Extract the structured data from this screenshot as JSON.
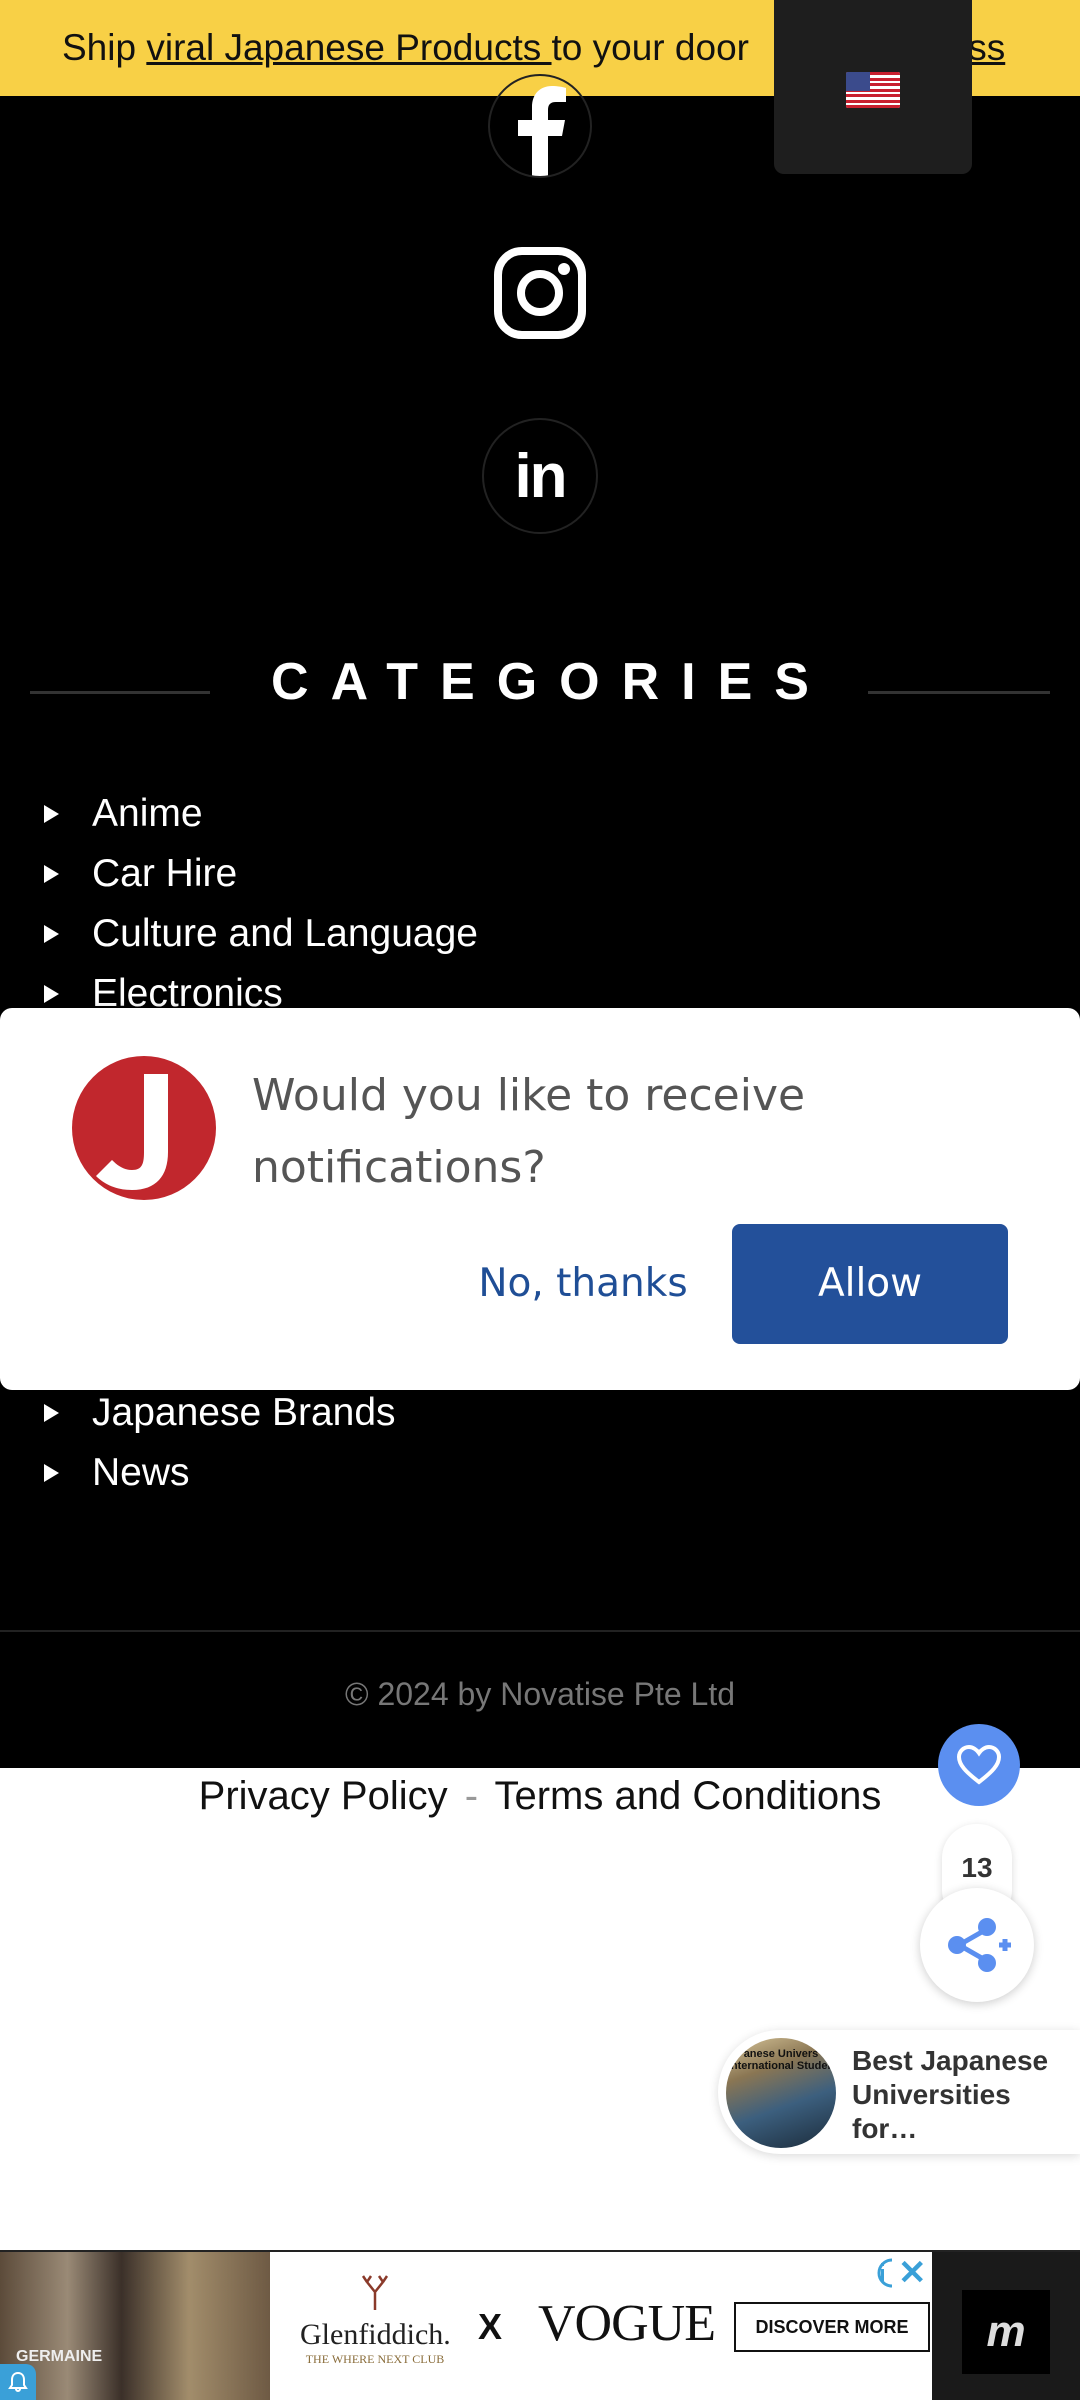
{
  "announcement": {
    "prefix": "Ship ",
    "link_text": "viral Japanese Products ",
    "middle": "to your door",
    "tail": "iss"
  },
  "language": {
    "selected": "English (US)",
    "flag_icon": "us-flag-icon"
  },
  "social": {
    "facebook_icon": "facebook-icon",
    "instagram_icon": "instagram-icon",
    "linkedin_label": "in"
  },
  "categories": {
    "title": "CATEGORIES",
    "items_top": [
      "Anime",
      "Car Hire",
      "Culture and Language",
      "Electronics"
    ],
    "items_bottom": [
      "Japanese Brands",
      "News"
    ]
  },
  "notification": {
    "message": "Would you like to receive notifications?",
    "no_label": "No, thanks",
    "allow_label": "Allow",
    "accent": "#23509a"
  },
  "footer": {
    "copyright": "© 2024 by Novatise Pte Ltd",
    "privacy_label": "Privacy Policy",
    "separator": "-",
    "terms_label": "Terms and Conditions"
  },
  "share": {
    "count": "13",
    "heart_color": "#5b8ff0"
  },
  "related": {
    "title": "Best Japanese Universities for…",
    "thumb_caption": "anese Univers International Studen"
  },
  "ad": {
    "photo_caption": "GERMAINE",
    "brand1": "Glenfiddich.",
    "brand1_sub": "THE WHERE NEXT CLUB",
    "x": "X",
    "brand2": "VOGUE",
    "cta": "DISCOVER MORE",
    "close": "✕",
    "logo": "m"
  }
}
